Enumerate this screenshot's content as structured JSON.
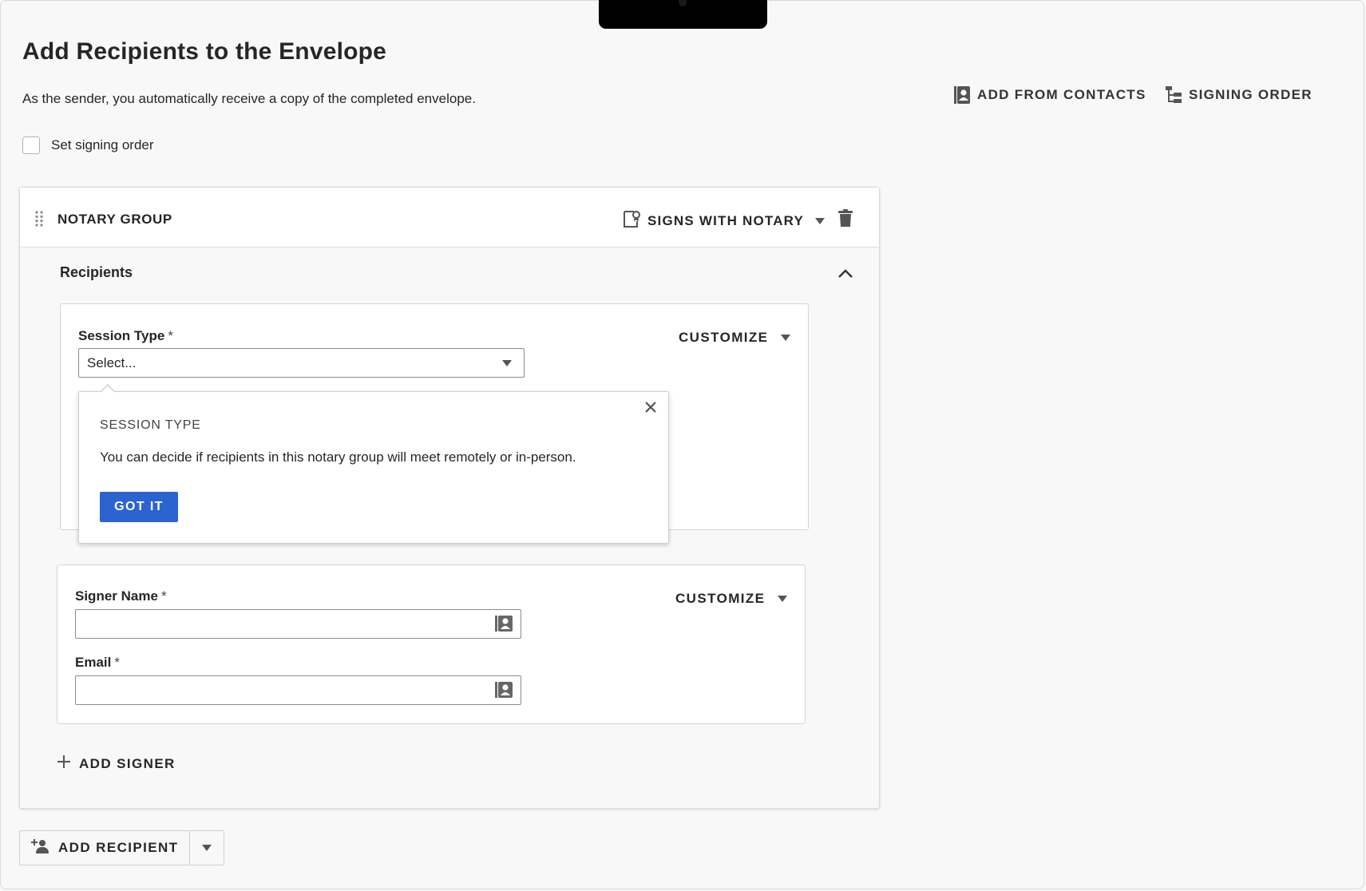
{
  "page": {
    "title": "Add Recipients to the Envelope",
    "subtitle": "As the sender, you automatically receive a copy of the completed envelope."
  },
  "top_actions": {
    "add_from_contacts": {
      "label": "ADD FROM CONTACTS",
      "icon": "contact-card-icon"
    },
    "signing_order": {
      "label": "SIGNING ORDER",
      "icon": "tree-icon"
    }
  },
  "signing_order_option": {
    "label": "Set signing order",
    "checked": false
  },
  "notary_group": {
    "title": "NOTARY GROUP",
    "dropdown_label": "SIGNS WITH NOTARY",
    "section_label": "Recipients",
    "session": {
      "label": "Session Type",
      "required_mark": "*",
      "select_value": "Select...",
      "customize_label": "CUSTOMIZE"
    },
    "signer": {
      "name_label": "Signer Name",
      "email_label": "Email",
      "required_mark": "*",
      "name_value": "",
      "email_value": "",
      "customize_label": "CUSTOMIZE"
    },
    "add_signer_label": "ADD SIGNER"
  },
  "popover": {
    "title": "SESSION TYPE",
    "body": "You can decide if recipients in this notary group will meet remotely or in-person.",
    "button_label": "GOT IT"
  },
  "add_recipient": {
    "label": "ADD RECIPIENT"
  },
  "colors": {
    "primary_button": "#2b63d1",
    "page_background": "#f8f8f8",
    "text": "#262626"
  }
}
